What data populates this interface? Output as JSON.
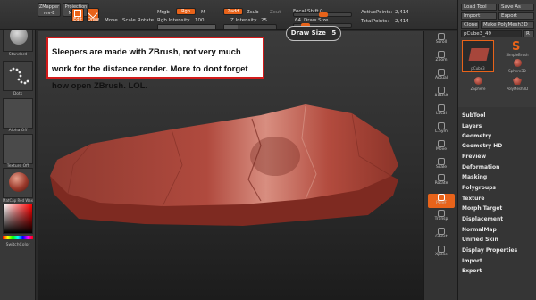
{
  "topbar": {
    "zmapper": "ZMapper",
    "zmapper_sub": "rev-E",
    "projection": "Projection",
    "projection_sub": "Master",
    "edit": "Edit",
    "draw": "Draw",
    "move": "Move",
    "scale": "Scale",
    "rotate": "Rotate",
    "mrgb": "Mrgb",
    "rgb": "Rgb",
    "m": "M",
    "rgb_intensity_label": "Rgb Intensity",
    "rgb_intensity_value": "100",
    "zadd": "Zadd",
    "zsub": "Zsub",
    "zcut": "Zcut",
    "z_intensity_label": "Z Intensity",
    "z_intensity_value": "25",
    "focal_shift_label": "Focal Shift",
    "focal_shift_value": "0",
    "draw_size_label": "Draw Size",
    "draw_size_value": "64",
    "active_points_label": "ActivePoints:",
    "active_points_value": "2,414",
    "total_points_label": "TotalPoints:",
    "total_points_value": "2,414"
  },
  "draw_size_popup": {
    "label": "Draw Size",
    "value": "5"
  },
  "annotation": {
    "text": "Sleepers are made with ZBrush, not very much work for the distance render. More to dont forget how open ZBrush. LOL."
  },
  "left_shelf": {
    "items": [
      {
        "label": "Standard"
      },
      {
        "label": "Dots"
      },
      {
        "label": "Alpha Off"
      },
      {
        "label": "Texture Off"
      },
      {
        "label": "MatCap Red Wax"
      }
    ],
    "switch_color": "SwitchColor"
  },
  "right_tools": [
    {
      "label": "Scroll"
    },
    {
      "label": "Zoom"
    },
    {
      "label": "Actual"
    },
    {
      "label": "AAHalf"
    },
    {
      "label": "Local"
    },
    {
      "label": "L.Sym"
    },
    {
      "label": "Move"
    },
    {
      "label": "Scale"
    },
    {
      "label": "Rotate"
    },
    {
      "label": "PolyF"
    },
    {
      "label": "Transp"
    },
    {
      "label": "Ghost"
    },
    {
      "label": "Xpose"
    }
  ],
  "right_panel": {
    "load_tool": "Load Tool",
    "save_as": "Save As",
    "import": "Import",
    "export": "Export",
    "clone": "Clone",
    "make_polymesh": "Make PolyMesh3D",
    "current_tool": "pCube3_49",
    "current_tool_count": "R",
    "thumbs": [
      {
        "label": "pCube3"
      },
      {
        "label": "SimpleBrush"
      },
      {
        "label": "Sphere3D"
      },
      {
        "label": "ZSphere"
      },
      {
        "label": "PolyMesh3D"
      }
    ],
    "menu": [
      "SubTool",
      "Layers",
      "Geometry",
      "Geometry HD",
      "Preview",
      "Deformation",
      "Masking",
      "Polygroups",
      "Texture",
      "Morph Target",
      "Displacement",
      "NormalMap",
      "Unified Skin",
      "Display Properties",
      "Import",
      "Export"
    ]
  },
  "colors": {
    "accent": "#e8631a",
    "annotation_border": "#d21a1a",
    "model": "#a7463b"
  }
}
